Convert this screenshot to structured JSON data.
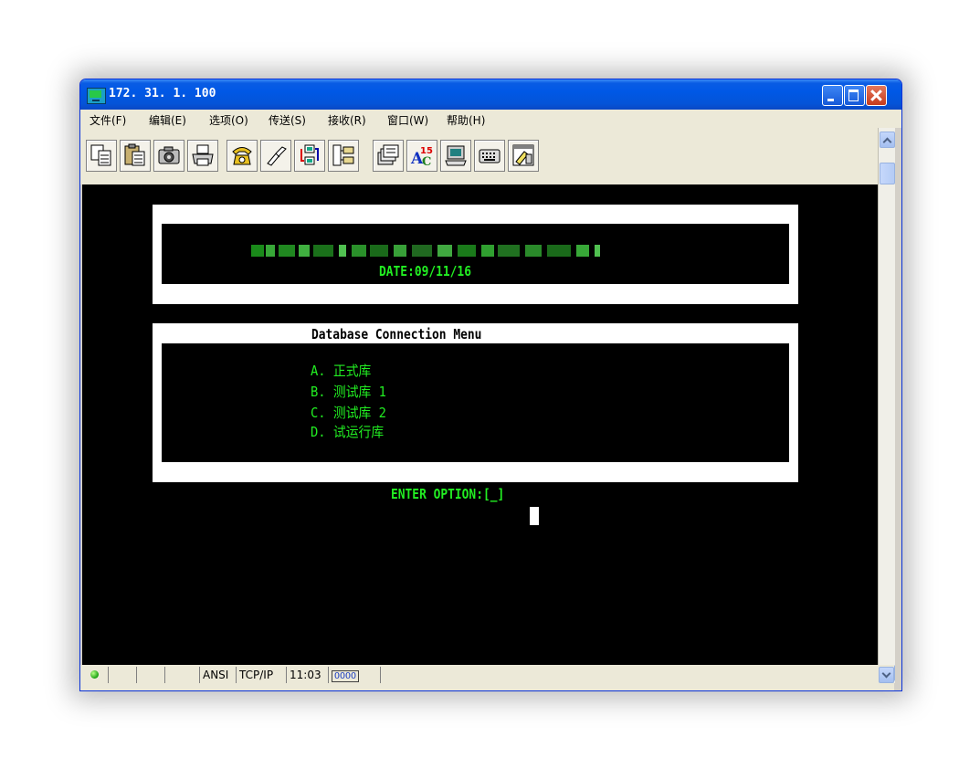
{
  "window": {
    "title": "172. 31. 1. 100"
  },
  "menu": {
    "items": [
      "文件(F)",
      "编辑(E)",
      "选项(O)",
      "传送(S)",
      "接收(R)",
      "窗口(W)",
      "帮助(H)"
    ]
  },
  "toolbar": {
    "buttons": [
      "copy-icon",
      "paste-icon",
      "camera-icon",
      "print-icon",
      "phone-icon",
      "disconnect-icon",
      "transfer-icon",
      "file-list-icon",
      "files-icon",
      "character-set-icon",
      "screen-icon",
      "keyboard-icon",
      "window-edit-icon"
    ]
  },
  "terminal": {
    "header": {
      "date_line": "DATE:09/11/16"
    },
    "menu_box": {
      "title": "Database Connection Menu",
      "options": [
        {
          "key": "A.",
          "label": "正式库"
        },
        {
          "key": "B.",
          "label": "测试库 1"
        },
        {
          "key": "C.",
          "label": "测试库 2"
        },
        {
          "key": "D.",
          "label": "试运行库"
        }
      ]
    },
    "prompt": "ENTER OPTION:[_]",
    "colors": {
      "foreground": "#22ee22",
      "background": "#000000",
      "box": "#ffffff"
    }
  },
  "statusbar": {
    "encoding": "ANSI",
    "protocol": "TCP/IP",
    "time": "11:03",
    "indicator": "OOOO"
  }
}
